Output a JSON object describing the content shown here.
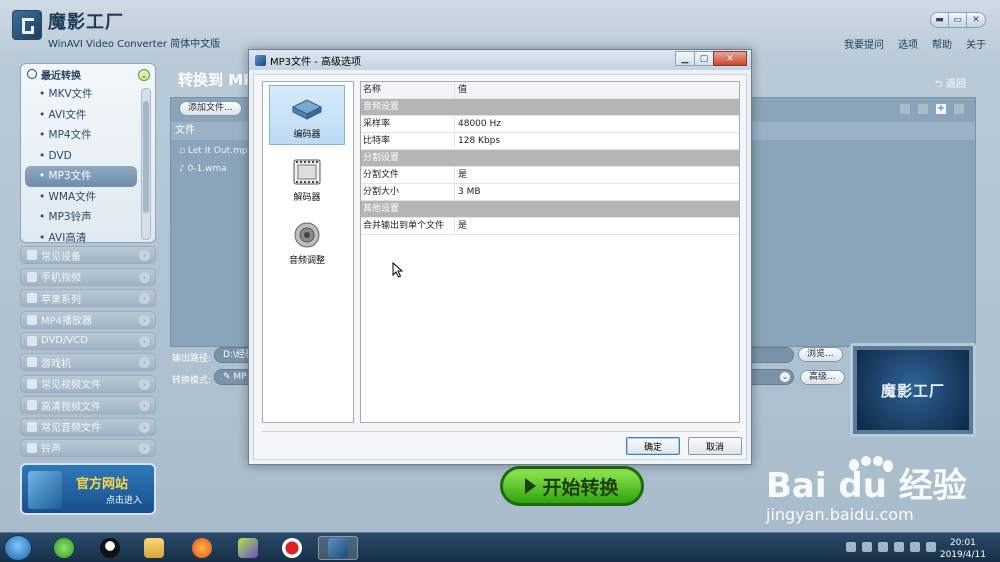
{
  "app": {
    "name": "魔影工厂",
    "subtitle": "WinAVI Video Converter 简体中文版",
    "menu": [
      "我要提问",
      "选项",
      "帮助",
      "关于"
    ]
  },
  "sidebar": {
    "recent_title": "最近转换",
    "recent_items": [
      "MKV文件",
      "AVI文件",
      "MP4文件",
      "DVD",
      "MP3文件",
      "WMA文件",
      "MP3铃声",
      "AVI高清"
    ],
    "selected_item": "MP3文件",
    "categories": [
      "常见设备",
      "手机视频",
      "苹果系列",
      "MP4播放器",
      "DVD/VCD",
      "游戏机",
      "常见视频文件",
      "高清视频文件",
      "常见音频文件",
      "铃声"
    ],
    "official_site": "官方网站",
    "official_enter": "点击进入"
  },
  "main": {
    "title": "转换到 MP",
    "back": "返回",
    "add_files": "添加文件...",
    "file_header": "文件",
    "files": [
      "Let It Out.mp",
      "0-1.wma"
    ],
    "output_label": "输出路径:",
    "output_path": "D:\\经验",
    "browse": "浏览...",
    "mode_label": "转换模式:",
    "mode_value": "MP",
    "advanced": "高级...",
    "preview_logo": "魔影工厂",
    "start": "开始转换"
  },
  "dialog": {
    "title": "MP3文件 - 高级选项",
    "tabs": [
      "编码器",
      "解码器",
      "音频调整"
    ],
    "selected_tab": "编码器",
    "header": {
      "name": "名称",
      "value": "值"
    },
    "groups": [
      {
        "label": "音频设置",
        "rows": [
          {
            "k": "采样率",
            "v": "48000 Hz"
          },
          {
            "k": "比特率",
            "v": "128 Kbps"
          }
        ]
      },
      {
        "label": "分割设置",
        "rows": [
          {
            "k": "分割文件",
            "v": "是"
          },
          {
            "k": "分割大小",
            "v": "3 MB"
          }
        ]
      },
      {
        "label": "其他设置",
        "rows": [
          {
            "k": "合并输出到单个文件",
            "v": "是"
          }
        ]
      }
    ],
    "ok": "确定",
    "cancel": "取消"
  },
  "taskbar": {
    "time": "20:01",
    "date": "2019/4/11"
  },
  "watermark": {
    "brand": "Bai du 经验",
    "url": "jingyan.baidu.com"
  }
}
